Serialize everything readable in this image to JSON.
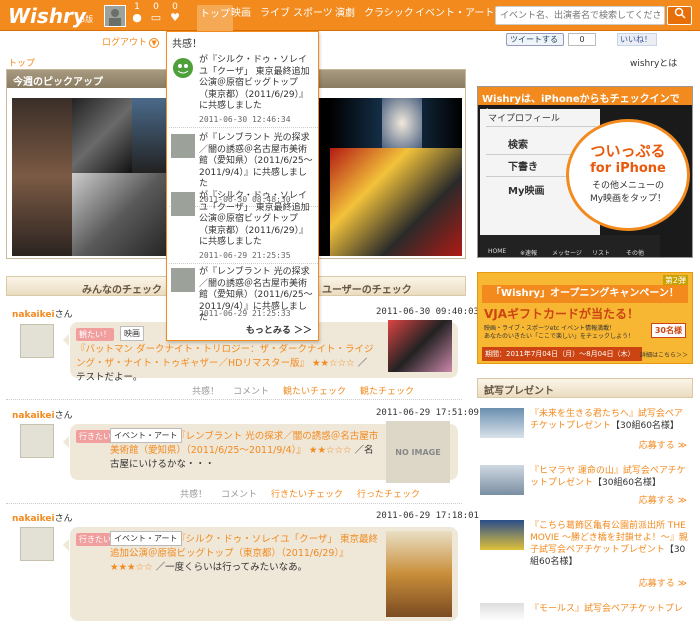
{
  "header": {
    "logo": "Wishry",
    "beta": "β版",
    "counters": [
      {
        "icon": "person-icon",
        "value": "1"
      },
      {
        "icon": "comment-icon",
        "value": "0"
      },
      {
        "icon": "heart-icon",
        "value": "0"
      }
    ],
    "tabs": [
      "トップ",
      "映画",
      "ライブ",
      "スポーツ",
      "演劇",
      "クラシック",
      "イベント・アート"
    ],
    "active_tab": "トップ",
    "search_placeholder": "イベント名、出演者名で検索してください",
    "search_icon": "search-icon"
  },
  "logout": {
    "label": "ログアウト",
    "icon": "circle-chevron-down-icon"
  },
  "social": {
    "tweet": "ツイートする",
    "tweet_count": "0",
    "like": "いいね！"
  },
  "breadcrumb": "トップ",
  "about_link": "wishryとは",
  "pickup": {
    "title": "今週のピックアップ"
  },
  "checks": {
    "tabs": [
      "みんなのチェック",
      "ユーザーのチェック"
    ]
  },
  "posts": [
    {
      "user": "nakaikei",
      "suffix": "さん",
      "date": "2011-06-30 09:40:03",
      "badge": "観たい！",
      "category": "映画",
      "title": "『バットマン ダークナイト・トリロジー：ザ・ダークナイト・ライジング・ザ・ナイト・トゥギャザー／HDリマスター版』",
      "rating": "★★☆☆☆",
      "comment": "／テストだよー。",
      "actions": [
        "共感！",
        "コメント",
        "観たいチェック",
        "観たチェック"
      ]
    },
    {
      "user": "nakaikei",
      "suffix": "さん",
      "date": "2011-06-29 17:51:09",
      "badge": "行きたい",
      "category": "イベント・アート",
      "title": "『レンブラント 光の探求／闇の誘惑＠名古屋市美術館（愛知県）（2011/6/25～2011/9/4）』",
      "rating": "★★☆☆☆",
      "comment": "／名古屋にいけるかな・・・",
      "noimage": "NO IMAGE",
      "actions": [
        "共感！",
        "コメント",
        "行きたいチェック",
        "行ったチェック"
      ]
    },
    {
      "user": "nakaikei",
      "suffix": "さん",
      "date": "2011-06-29 17:18:01",
      "badge": "行きたい",
      "category": "イベント・アート",
      "title": "『シルク・ドゥ・ソレイユ「クーザ」 東京最終追加公演＠原宿ビッグトップ（東京都）（2011/6/29）』",
      "rating": "★★★☆☆",
      "comment": "／一度くらいは行ってみたいなあ。"
    }
  ],
  "banner": {
    "title": "Wishryは、iPhoneからもチェックインできる！",
    "menu": [
      "マイプロフィール",
      "検索",
      "下書き",
      "My映画"
    ],
    "callout": [
      "ついっぷる",
      "for iPhone",
      "その他メニューの",
      "My映画をタップ！"
    ],
    "tabbar": [
      "HOME",
      "※速報",
      "メッセージ",
      "リスト",
      "その他"
    ]
  },
  "campaign": {
    "round": "第2弾",
    "title": "「Wishry」オープニングキャンペーン！",
    "line1": "VJAギフトカードが当たる！",
    "line2": "映画・ライブ・スポーツetc イベント情報満載！",
    "line3": "あなたのいきたい「ここで楽しい」をチェックしよう！",
    "prize": "30名様",
    "period": "期間：2011年7月04日（月）～8月04日（木）",
    "details": "詳細はこちら＞＞"
  },
  "presents": {
    "title": "試写プレゼント",
    "items": [
      {
        "title": "『未来を生きる君たちへ』試写会ペアチケットプレゼント",
        "prize": "【30組60名様】",
        "apply": "応募する"
      },
      {
        "title": "『ヒマラヤ 運命の山』試写会ペアチケットプレゼント",
        "prize": "【30組60名様】",
        "apply": "応募する"
      },
      {
        "title": "『こちら葛飾区亀有公園前派出所 THE MOVIE ～勝どき橋を封鎖せよ！～』親子試写会ペアチケットプレゼント",
        "prize": "【30組60名様】",
        "apply": "応募する"
      },
      {
        "title": "『モールス』試写会ペアチケットプレ"
      }
    ]
  },
  "dropdown": {
    "title": "共感！",
    "items": [
      {
        "text": "が『シルク・ドゥ・ソレイユ「クーザ」 東京最終追加公演＠原宿ビッグトップ（東京都）（2011/6/29）』に共感しました",
        "time": "2011-06-30 12:46:34"
      },
      {
        "text": "が『レンブラント 光の探求／闇の誘惑＠名古屋市美術館（愛知県）（2011/6/25～2011/9/4）』に共感しました",
        "time": "2011-06-30 08:48:30"
      },
      {
        "text": "が『シルク・ドゥ・ソレイユ「クーザ」 東京最終追加公演＠原宿ビッグトップ（東京都）（2011/6/29）』に共感しました",
        "time": "2011-06-29 21:25:35"
      },
      {
        "text": "が『レンブラント 光の探求／闇の誘惑＠名古屋市美術館（愛知県）（2011/6/25～2011/9/4）』に共感しました",
        "time": "2011-06-29 21:25:33"
      }
    ],
    "more": "もっとみる ＞＞"
  },
  "colors": {
    "accent": "#f28a1e",
    "bubble": "#efe7d8"
  }
}
